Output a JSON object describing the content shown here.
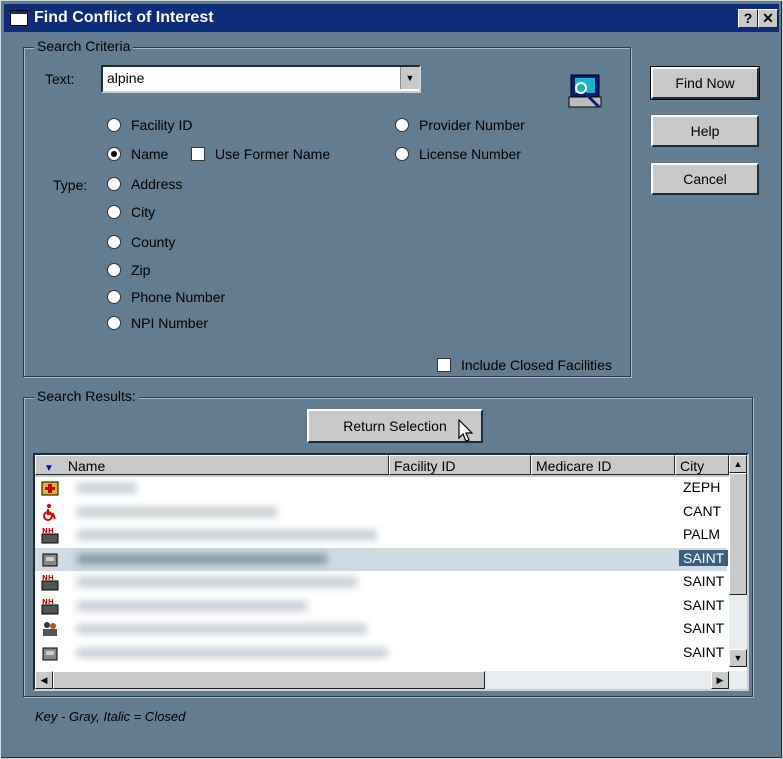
{
  "window": {
    "title": "Find Conflict of Interest",
    "help_glyph": "?",
    "close_glyph": "✕"
  },
  "criteria": {
    "group_label": "Search Criteria",
    "text_label": "Text:",
    "text_value": "alpine",
    "type_label": "Type:",
    "radios_left": [
      {
        "label": "Facility ID",
        "checked": false
      },
      {
        "label": "Name",
        "checked": true
      },
      {
        "label": "Address",
        "checked": false
      },
      {
        "label": "City",
        "checked": false
      },
      {
        "label": "County",
        "checked": false
      },
      {
        "label": "Zip",
        "checked": false
      },
      {
        "label": "Phone Number",
        "checked": false
      },
      {
        "label": "NPI Number",
        "checked": false
      }
    ],
    "use_former_name": "Use Former Name",
    "radios_right": [
      {
        "label": "Provider Number",
        "checked": false
      },
      {
        "label": "License Number",
        "checked": false
      }
    ],
    "include_closed": "Include Closed Facilities"
  },
  "buttons": {
    "find_now": "Find Now",
    "help": "Help",
    "cancel": "Cancel",
    "return_selection": "Return Selection"
  },
  "results": {
    "group_label": "Search Results:",
    "columns": [
      "Name",
      "Facility ID",
      "Medicare ID",
      "City"
    ],
    "rows": [
      {
        "icon": "hospital-icon",
        "city": "ZEPH",
        "selected": false
      },
      {
        "icon": "wheelchair-icon",
        "city": "CANT",
        "selected": false
      },
      {
        "icon": "nursing-home-icon",
        "city": "PALM",
        "selected": false
      },
      {
        "icon": "facility-icon",
        "city": "SAINT",
        "selected": true
      },
      {
        "icon": "nursing-home-icon",
        "city": "SAINT",
        "selected": false
      },
      {
        "icon": "nursing-home-icon",
        "city": "SAINT",
        "selected": false
      },
      {
        "icon": "people-icon",
        "city": "SAINT",
        "selected": false
      },
      {
        "icon": "facility-icon",
        "city": "SAINT",
        "selected": false
      }
    ]
  },
  "key_text": "Key - Gray, Italic = Closed"
}
